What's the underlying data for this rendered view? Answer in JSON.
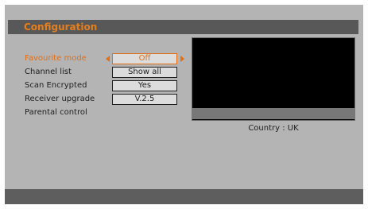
{
  "window": {
    "title": "Configuration"
  },
  "menu": {
    "items": [
      {
        "label": "Favourite mode",
        "value": "Off",
        "active": true
      },
      {
        "label": "Channel list",
        "value": "Show all"
      },
      {
        "label": "Scan Encrypted",
        "value": "Yes"
      },
      {
        "label": "Receiver upgrade",
        "value": "V.2.5"
      },
      {
        "label": "Parental control"
      }
    ]
  },
  "preview": {
    "country": "Country : UK"
  },
  "colors": {
    "accent": "#e06f17",
    "panel": "#b4b4b4",
    "bars": "#585858"
  },
  "icons": [
    "arrow-left-icon",
    "arrow-right-icon"
  ]
}
